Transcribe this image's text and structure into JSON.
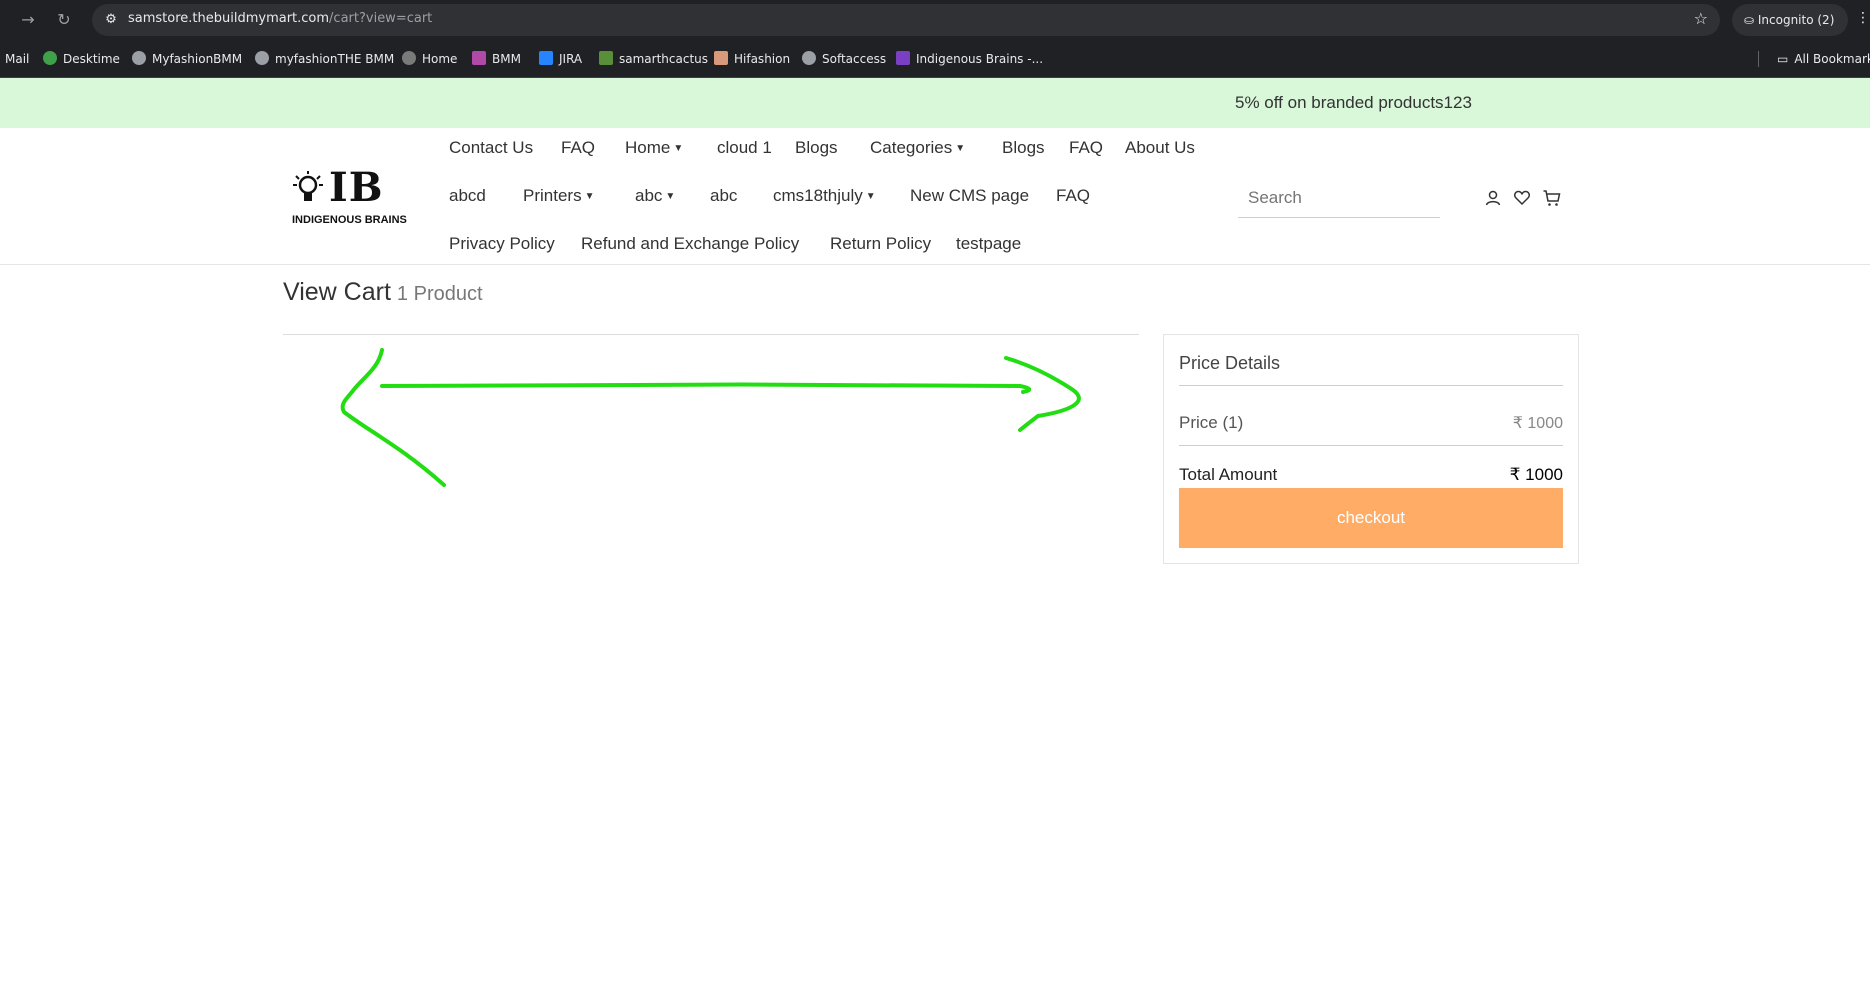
{
  "browser": {
    "url_host": "samstore.thebuildmymart.com",
    "url_path": "/cart?view=cart",
    "incognito_label": "Incognito (2)",
    "bookmarks": [
      {
        "label": "Mail",
        "color": ""
      },
      {
        "label": "Desktime",
        "color": "#3fa14a"
      },
      {
        "label": "MyfashionBMM",
        "color": "#9aa0a6"
      },
      {
        "label": "myfashionTHE BMM",
        "color": "#9aa0a6"
      },
      {
        "label": "Home",
        "color": "#7a7a7a"
      },
      {
        "label": "BMM",
        "color": "#b04aa6"
      },
      {
        "label": "JIRA",
        "color": "#2684ff"
      },
      {
        "label": "samarthcactus",
        "color": "#5a8f3a"
      },
      {
        "label": "Hifashion",
        "color": "#d89a7a"
      },
      {
        "label": "Softaccess",
        "color": "#9aa0a6"
      },
      {
        "label": "Indigenous Brains -...",
        "color": "#7b3fc4"
      }
    ],
    "all_bookmarks_label": "All Bookmarks"
  },
  "announcement": "5% off on branded products123",
  "logo": {
    "main": "IB",
    "sub": "INDIGENOUS BRAINS"
  },
  "menu": {
    "row1": [
      "Contact Us",
      "FAQ",
      "Home",
      "cloud 1",
      "Blogs",
      "Categories",
      "Blogs",
      "FAQ",
      "About Us"
    ],
    "row2": [
      "abcd",
      "Printers",
      "abc",
      "abc",
      "cms18thjuly",
      "New CMS page",
      "FAQ"
    ],
    "row3": [
      "Privacy Policy",
      "Refund and Exchange Policy",
      "Return Policy",
      "testpage"
    ]
  },
  "search": {
    "placeholder": "Search"
  },
  "icons": {
    "user": "user-icon",
    "wishlist": "heart-icon",
    "cart": "cart-icon"
  },
  "cart": {
    "title": "View Cart",
    "count": "1 Product"
  },
  "price_details": {
    "title": "Price Details",
    "price_label": "Price (1)",
    "price_value": "₹ 1000",
    "total_label": "Total Amount",
    "total_value": "₹ 1000",
    "checkout_label": "checkout"
  },
  "colors": {
    "announce_bg": "#d9f7d9",
    "checkout_bg": "#ffad66",
    "annotation_arrow": "#22dd11"
  }
}
